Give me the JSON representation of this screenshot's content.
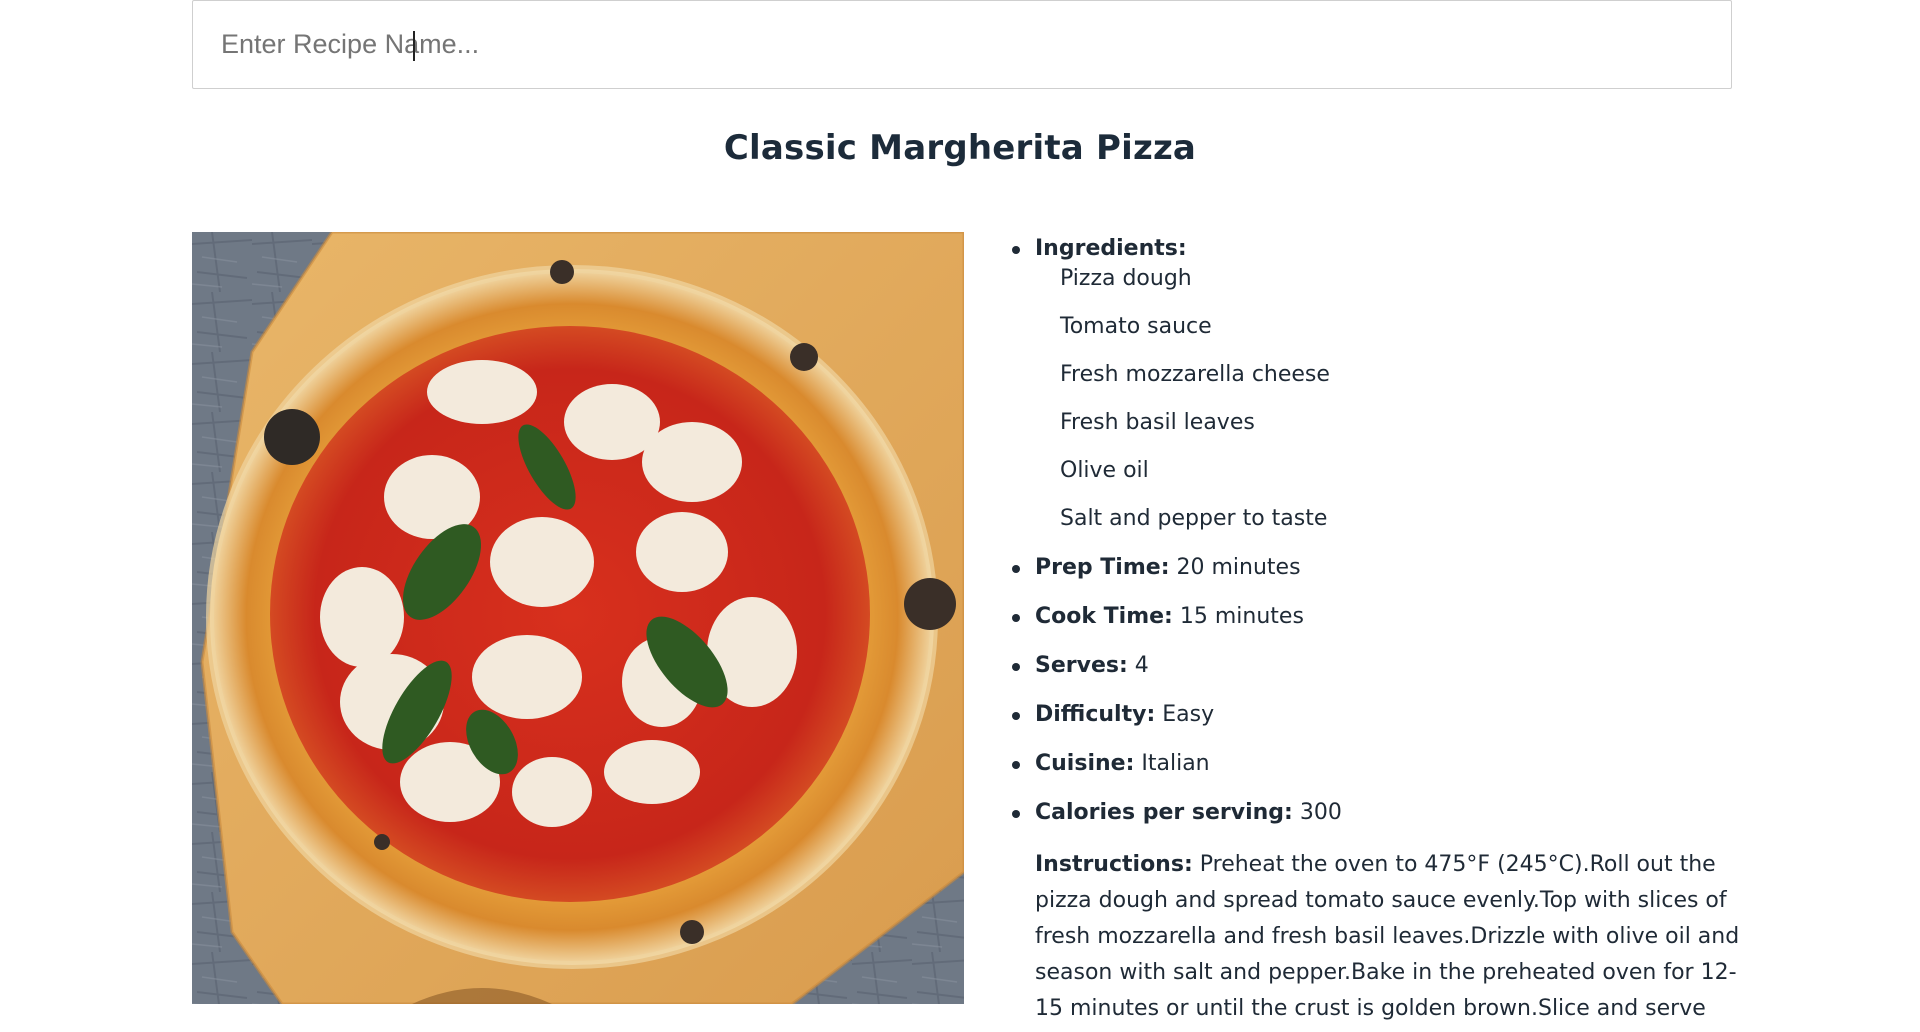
{
  "search": {
    "placeholder": "Enter Recipe Name...",
    "value": ""
  },
  "recipe": {
    "title": "Classic Margherita Pizza",
    "ingredients_label": "Ingredients:",
    "ingredients": [
      "Pizza dough",
      "Tomato sauce",
      "Fresh mozzarella cheese",
      "Fresh basil leaves",
      "Olive oil",
      "Salt and pepper to taste"
    ],
    "prep_time": {
      "label": "Prep Time:",
      "value": "20 minutes"
    },
    "cook_time": {
      "label": "Cook Time:",
      "value": "15 minutes"
    },
    "serves": {
      "label": "Serves:",
      "value": "4"
    },
    "difficulty": {
      "label": "Difficulty:",
      "value": "Easy"
    },
    "cuisine": {
      "label": "Cuisine:",
      "value": "Italian"
    },
    "calories": {
      "label": "Calories per serving:",
      "value": "300"
    },
    "instructions": {
      "label": "Instructions:",
      "value": "Preheat the oven to 475°F (245°C).Roll out the pizza dough and spread tomato sauce evenly.Top with slices of fresh mozzarella and fresh basil leaves.Drizzle with olive oil and season with salt and pepper.Bake in the preheated oven for 12-15 minutes or until the crust is golden brown.Slice and serve hot."
    }
  },
  "colors": {
    "text": "#1f2a36",
    "title": "#1c2b3a",
    "input_border": "#cfcfcf",
    "placeholder": "#757575"
  }
}
